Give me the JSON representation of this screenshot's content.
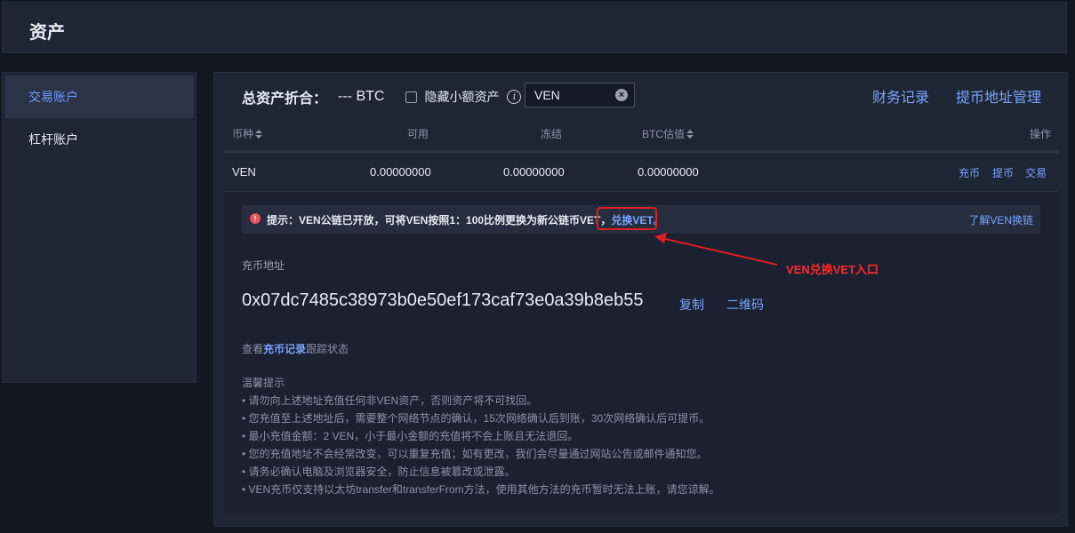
{
  "header": {
    "title": "资产"
  },
  "sidebar": {
    "items": [
      {
        "label": "交易账户"
      },
      {
        "label": "杠杆账户"
      }
    ]
  },
  "summary": {
    "label": "总资产折合：",
    "value": "--- BTC",
    "hide_small_label": "隐藏小额资产",
    "search_value": "VEN",
    "records_link": "财务记录",
    "address_mgmt_link": "提币地址管理"
  },
  "table": {
    "headers": {
      "coin": "币种",
      "available": "可用",
      "frozen": "冻结",
      "btc_value": "BTC估值",
      "actions": "操作"
    },
    "row": {
      "coin": "VEN",
      "available": "0.00000000",
      "frozen": "0.00000000",
      "btc_value": "0.00000000",
      "actions": {
        "deposit": "充币",
        "withdraw": "提币",
        "trade": "交易"
      }
    }
  },
  "detail": {
    "tip_text": "提示：VEN公链已开放，可将VEN按照1：100比例更换为新公链币VET，",
    "tip_link": "兑换VET。",
    "tip_right_link": "了解VEN换链",
    "annotation": "VEN兑换VET入口",
    "address_label": "充币地址",
    "address": "0x07dc7485c38973b0e50ef173caf73e0a39b8eb55",
    "copy": "复制",
    "qrcode": "二维码",
    "record_prefix": "查看",
    "record_link": "充币记录",
    "record_suffix": "跟踪状态",
    "notes_title": "温馨提示",
    "notes": [
      "• 请勿向上述地址充值任何非VEN资产，否则资产将不可找回。",
      "• 您充值至上述地址后，需要整个网络节点的确认，15次网络确认后到账，30次网络确认后可提币。",
      "• 最小充值金额：2 VEN，小于最小金额的充值将不会上账且无法退回。",
      "• 您的充值地址不会经常改变，可以重复充值；如有更改，我们会尽量通过网站公告或邮件通知您。",
      "• 请务必确认电脑及浏览器安全，防止信息被篡改或泄露。",
      "• VEN充币仅支持以太坊transfer和transferFrom方法，使用其他方法的充币暂时无法上账，请您谅解。"
    ]
  },
  "colors": {
    "accent": "#7aa5ff",
    "annotation": "#e01e1e",
    "background": "#131722",
    "panel": "#1e2535"
  },
  "icons": {
    "info": "info-circle-icon",
    "warn": "alert-circle-icon",
    "clear": "clear-circle-icon",
    "sort": "sort-icon"
  }
}
